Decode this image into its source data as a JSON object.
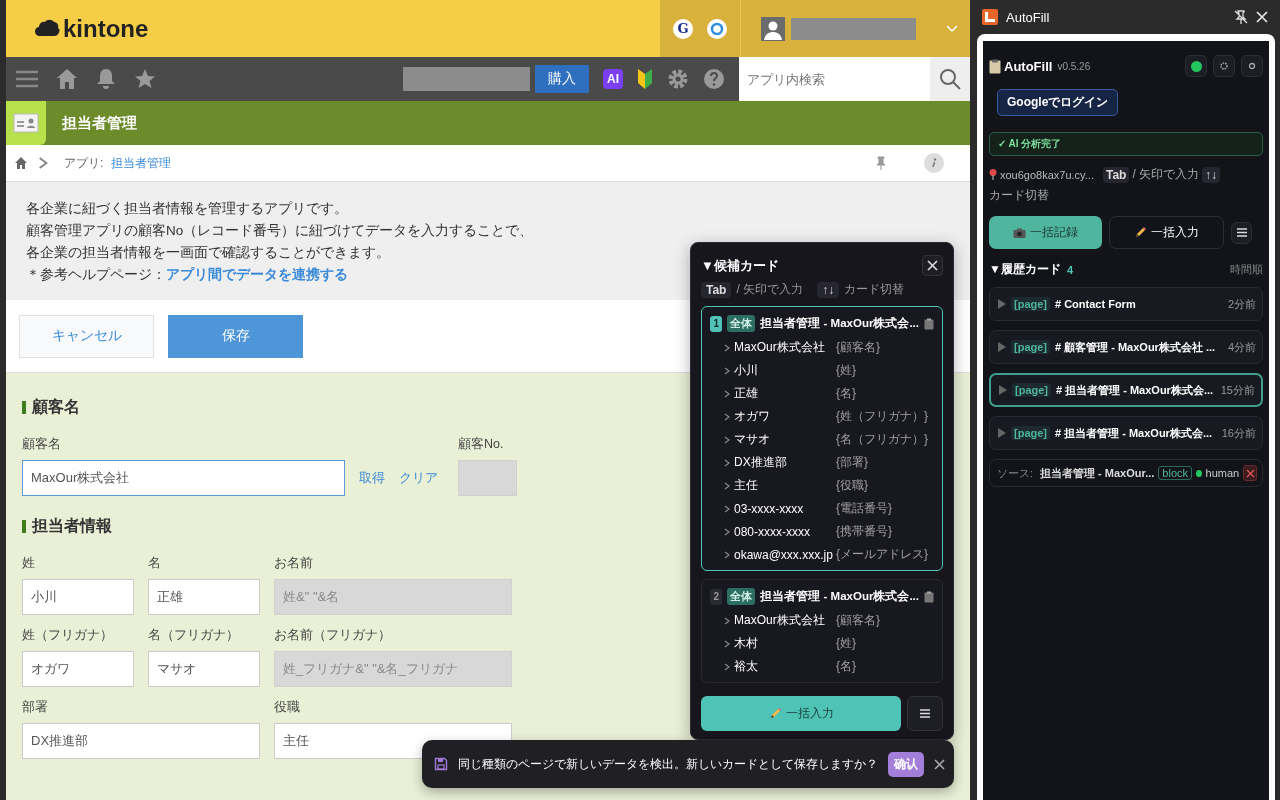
{
  "header": {
    "logo": "kintone",
    "google_badge": "G"
  },
  "toolbar": {
    "purchase_button": "購入",
    "ai_badge": "AI",
    "search": {
      "placeholder": "アプリ内検索"
    }
  },
  "app": {
    "title": "担当者管理",
    "breadcrumb": {
      "prefix": "アプリ:",
      "link": "担当者管理"
    },
    "description": [
      "各企業に紐づく担当者情報を管理するアプリです。",
      "顧客管理アプリの顧客No（レコード番号）に紐づけてデータを入力することで、",
      "各企業の担当者情報を一画面で確認することができます。"
    ],
    "help": {
      "text": "＊参考ヘルプページ：",
      "link": "アプリ間でデータを連携する"
    }
  },
  "buttons": [
    {
      "label": "キャンセル",
      "kind": "secondary"
    },
    {
      "label": "保存",
      "kind": "primary"
    }
  ],
  "sections": [
    {
      "title": "顧客名",
      "rows": [
        [
          {
            "label": "顧客名",
            "value": "MaxOur株式会社",
            "kind": "lookup",
            "actions": [
              "取得",
              "クリア"
            ]
          },
          {
            "label": "顧客No.",
            "kind": "readonly"
          }
        ]
      ]
    },
    {
      "title": "担当者情報",
      "rows": [
        [
          {
            "label": "姓",
            "value": "小川",
            "kind": "text"
          },
          {
            "label": "名",
            "value": "正雄",
            "kind": "text"
          },
          {
            "label": "お名前",
            "value": "姓&\" \"&名",
            "kind": "formula"
          }
        ],
        [
          {
            "label": "姓（フリガナ）",
            "value": "オガワ",
            "kind": "text"
          },
          {
            "label": "名（フリガナ）",
            "value": "マサオ",
            "kind": "text"
          },
          {
            "label": "お名前（フリガナ）",
            "value": "姓_フリガナ&\" \"&名_フリガナ",
            "kind": "formula"
          }
        ],
        [
          {
            "label": "部署",
            "value": "DX推進部",
            "kind": "text"
          },
          "",
          {
            "label": "役職",
            "value": "主任",
            "kind": "text"
          }
        ]
      ]
    }
  ],
  "candidates": {
    "title": "▼候補カード",
    "hints": [
      {
        "key": "Tab",
        "text": "/ 矢印で入力"
      },
      {
        "key": "↑↓",
        "text": "カード切替"
      }
    ],
    "cards": [
      {
        "number": "1",
        "scope": "全体",
        "title": "担当者管理 - MaxOur株式会...",
        "selected": true,
        "entries": [
          {
            "value": "MaxOur株式会社",
            "field": "{顧客名}"
          },
          {
            "value": "小川",
            "field": "{姓}"
          },
          {
            "value": "正雄",
            "field": "{名}"
          },
          {
            "value": "オガワ",
            "field": "{姓（フリガナ）}"
          },
          {
            "value": "マサオ",
            "field": "{名（フリガナ）}"
          },
          {
            "value": "DX推進部",
            "field": "{部署}"
          },
          {
            "value": "主任",
            "field": "{役職}"
          },
          {
            "value": "03-xxxx-xxxx",
            "field": "{電話番号}"
          },
          {
            "value": "080-xxxx-xxxx",
            "field": "{携帯番号}"
          },
          {
            "value": "okawa@xxx.xxx.jp",
            "field": "{メールアドレス}"
          }
        ]
      },
      {
        "number": "2",
        "scope": "全体",
        "title": "担当者管理 - MaxOur株式会...",
        "selected": false,
        "entries": [
          {
            "value": "MaxOur株式会社",
            "field": "{顧客名}"
          },
          {
            "value": "木村",
            "field": "{姓}"
          },
          {
            "value": "裕太",
            "field": "{名}"
          }
        ]
      }
    ],
    "fill_button": "一括入力"
  },
  "toast": {
    "message": "同じ種類のページで新しいデータを検出。新しいカードとして保存しますか？",
    "confirm": "确认"
  },
  "panel": {
    "window_title": "AutoFill",
    "name": "AutoFill",
    "version": "v0.5.26",
    "connected": true,
    "login_button": "Googleでログイン",
    "banner": "✓ AI 分析完了",
    "location": "xou6go8kax7u.cy...",
    "hints": [
      {
        "key": "Tab",
        "text": "/ 矢印で入力"
      },
      {
        "key": "↑↓",
        "text": "カード切替"
      }
    ],
    "record_button": "一括記録",
    "fill_button": "一括入力",
    "history": {
      "title": "▼履歴カード",
      "count": "4",
      "sort": "時間順",
      "items": [
        {
          "tag": "[page]",
          "title": "# Contact Form",
          "time": "2分前",
          "selected": false
        },
        {
          "tag": "[page]",
          "title": "# 顧客管理 - MaxOur株式会社 ...",
          "time": "4分前",
          "selected": false
        },
        {
          "tag": "[page]",
          "title": "# 担当者管理 - MaxOur株式会...",
          "time": "15分前",
          "selected": true
        },
        {
          "tag": "[page]",
          "title": "# 担当者管理 - MaxOur株式会...",
          "time": "16分前",
          "selected": false
        }
      ]
    },
    "source": {
      "label": "ソース:",
      "title": "担当者管理 - MaxOur...",
      "tag": "block",
      "author": "human",
      "author_active": true
    }
  }
}
